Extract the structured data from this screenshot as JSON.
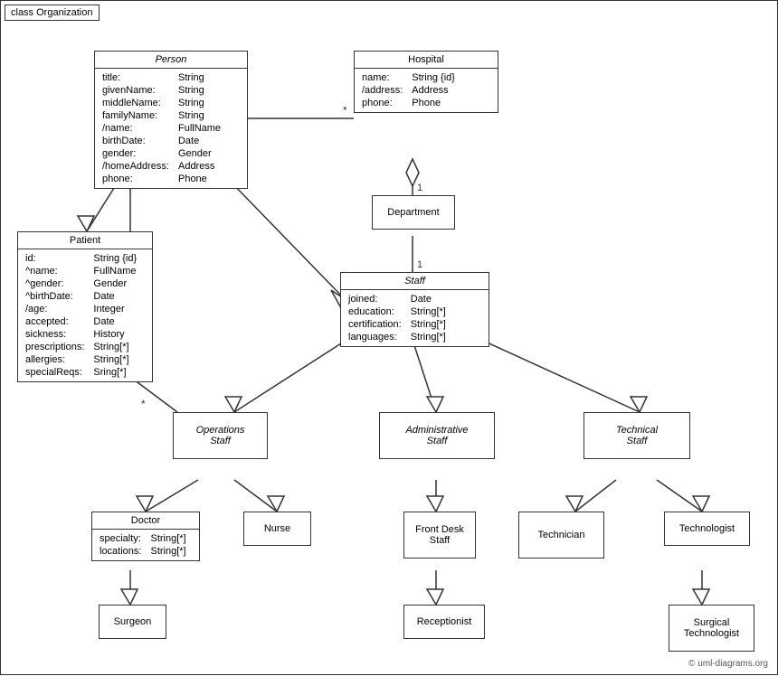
{
  "diagram": {
    "title": "class Organization",
    "copyright": "© uml-diagrams.org",
    "classes": {
      "person": {
        "name": "Person",
        "italic": true,
        "attrs": [
          [
            "title:",
            "String"
          ],
          [
            "givenName:",
            "String"
          ],
          [
            "middleName:",
            "String"
          ],
          [
            "familyName:",
            "String"
          ],
          [
            "/name:",
            "FullName"
          ],
          [
            "birthDate:",
            "Date"
          ],
          [
            "gender:",
            "Gender"
          ],
          [
            "/homeAddress:",
            "Address"
          ],
          [
            "phone:",
            "Phone"
          ]
        ]
      },
      "hospital": {
        "name": "Hospital",
        "italic": false,
        "attrs": [
          [
            "name:",
            "String {id}"
          ],
          [
            "/address:",
            "Address"
          ],
          [
            "phone:",
            "Phone"
          ]
        ]
      },
      "department": {
        "name": "Department",
        "italic": false,
        "attrs": []
      },
      "staff": {
        "name": "Staff",
        "italic": true,
        "attrs": [
          [
            "joined:",
            "Date"
          ],
          [
            "education:",
            "String[*]"
          ],
          [
            "certification:",
            "String[*]"
          ],
          [
            "languages:",
            "String[*]"
          ]
        ]
      },
      "patient": {
        "name": "Patient",
        "italic": false,
        "attrs": [
          [
            "id:",
            "String {id}"
          ],
          [
            "^name:",
            "FullName"
          ],
          [
            "^gender:",
            "Gender"
          ],
          [
            "^birthDate:",
            "Date"
          ],
          [
            "/age:",
            "Integer"
          ],
          [
            "accepted:",
            "Date"
          ],
          [
            "sickness:",
            "History"
          ],
          [
            "prescriptions:",
            "String[*]"
          ],
          [
            "allergies:",
            "String[*]"
          ],
          [
            "specialReqs:",
            "Sring[*]"
          ]
        ]
      },
      "operations_staff": {
        "name": "Operations\nStaff",
        "italic": true
      },
      "administrative_staff": {
        "name": "Administrative\nStaff",
        "italic": true
      },
      "technical_staff": {
        "name": "Technical\nStaff",
        "italic": true
      },
      "doctor": {
        "name": "Doctor",
        "attrs": [
          [
            "specialty:",
            "String[*]"
          ],
          [
            "locations:",
            "String[*]"
          ]
        ]
      },
      "nurse": {
        "name": "Nurse"
      },
      "front_desk_staff": {
        "name": "Front Desk\nStaff"
      },
      "technician": {
        "name": "Technician"
      },
      "technologist": {
        "name": "Technologist"
      },
      "surgeon": {
        "name": "Surgeon"
      },
      "receptionist": {
        "name": "Receptionist"
      },
      "surgical_technologist": {
        "name": "Surgical\nTechnologist"
      }
    },
    "labels": {
      "star": "*",
      "one": "1"
    }
  }
}
